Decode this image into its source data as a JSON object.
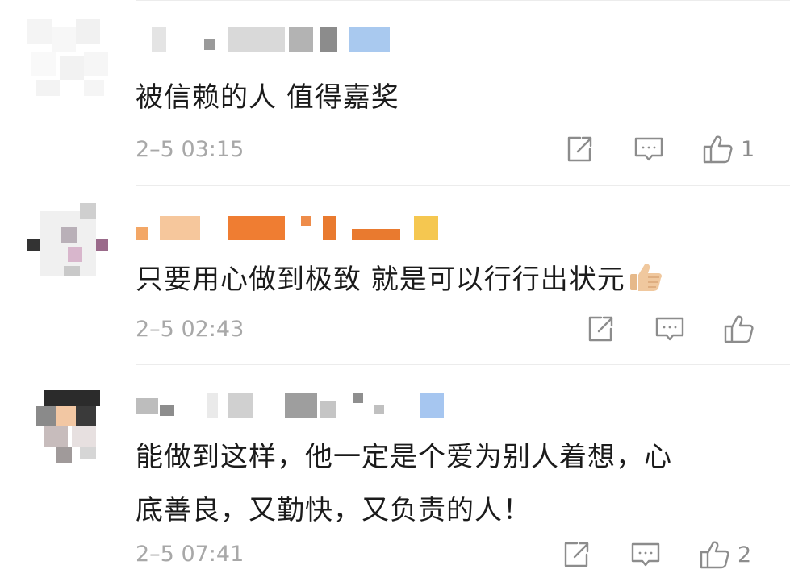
{
  "comments": [
    {
      "text": "被信赖的人 值得嘉奖",
      "time": "2–5 03:15",
      "likes": "1",
      "icons": {
        "share": "share-icon",
        "reply": "comment-icon",
        "like": "thumbs-up-icon"
      }
    },
    {
      "text": "只要用心做到极致 就是可以行行出状元",
      "emoji": "thumbs-up-emoji",
      "time": "2–5 02:43",
      "likes": "",
      "icons": {
        "share": "share-icon",
        "reply": "comment-icon",
        "like": "thumbs-up-icon"
      }
    },
    {
      "text_line1": "能做到这样，他一定是个爱为别人着想，心",
      "text_line2": "底善良，又勤快，又负责的人！",
      "time": "2–5 07:41",
      "likes": "2",
      "icons": {
        "share": "share-icon",
        "reply": "comment-icon",
        "like": "thumbs-up-icon"
      }
    }
  ],
  "colors": {
    "text": "#1b1b1b",
    "meta": "#a8a8a8",
    "divider": "#ececec",
    "icon": "#8c8c8c"
  }
}
